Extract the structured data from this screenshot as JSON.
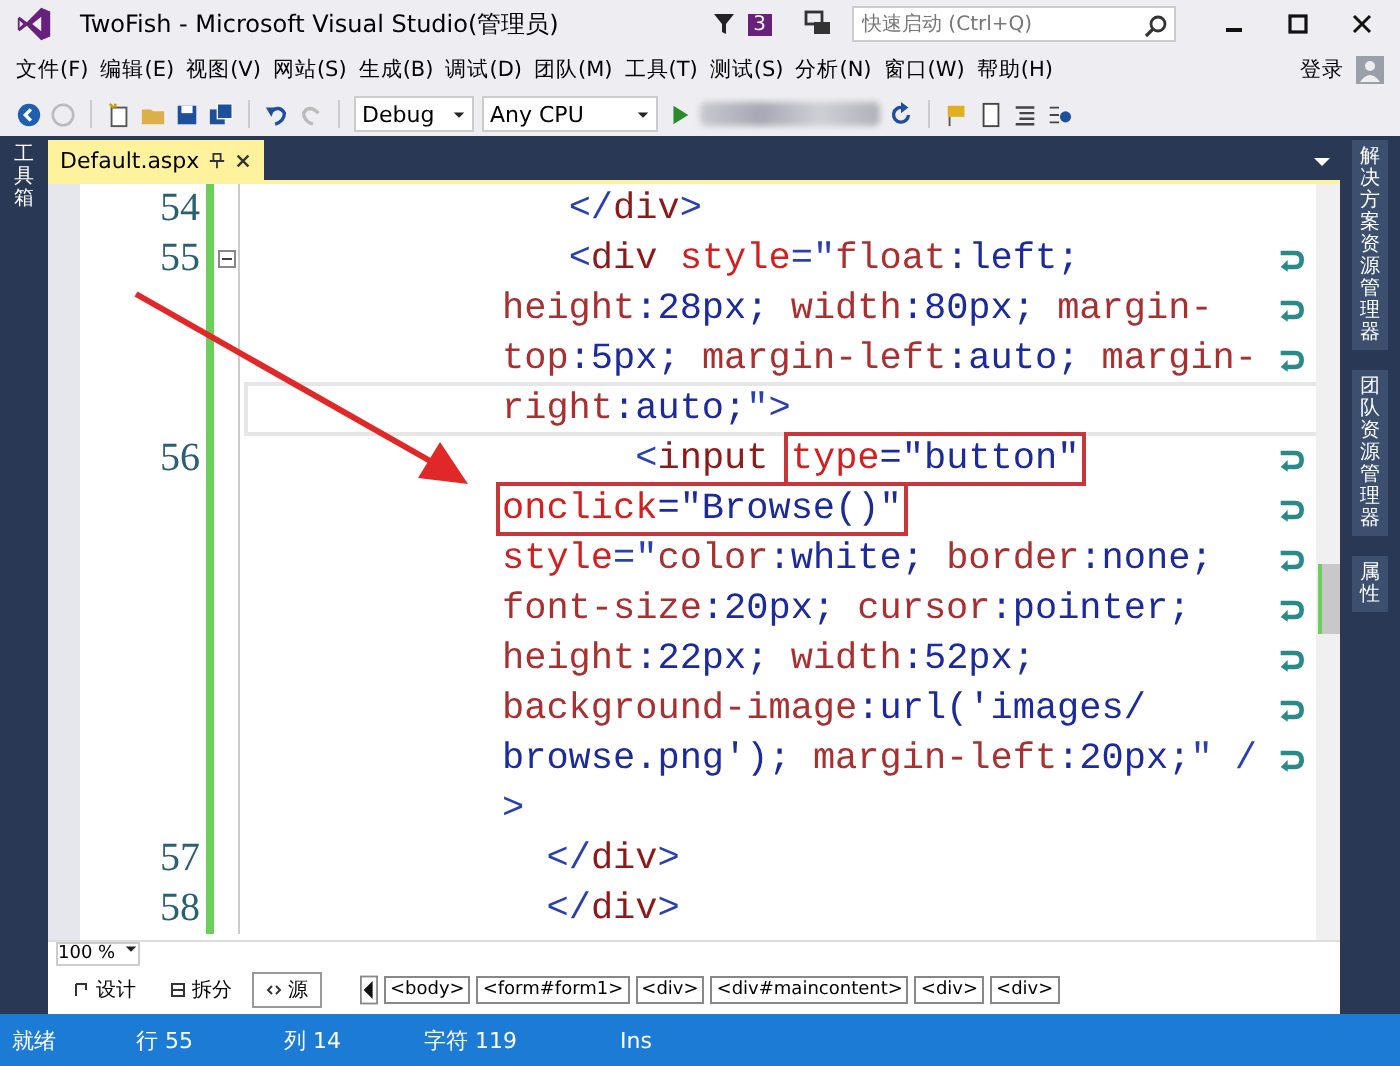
{
  "window": {
    "title": "TwoFish - Microsoft Visual Studio(管理员)",
    "notification_count": "3",
    "quick_launch": {
      "placeholder": "快速启动 (Ctrl+Q)"
    }
  },
  "menu": [
    "文件(F)",
    "编辑(E)",
    "视图(V)",
    "网站(S)",
    "生成(B)",
    "调试(D)",
    "团队(M)",
    "工具(T)",
    "测试(S)",
    "分析(N)",
    "窗口(W)",
    "帮助(H)"
  ],
  "sign_in": "登录",
  "toolbar": {
    "configuration": "Debug",
    "platform": "Any CPU"
  },
  "left_panel": {
    "label": "工具箱"
  },
  "tabs": [
    {
      "label": "Default.aspx",
      "selected": true
    }
  ],
  "right_panel": [
    {
      "label": "解决方案资源管理器"
    },
    {
      "label": "团队资源管理器"
    },
    {
      "label": "属性"
    }
  ],
  "editor": {
    "rows": [
      {
        "number": "54",
        "kind": "inner",
        "wrap": false,
        "current": false,
        "tokens": [
          {
            "kind": "bracket",
            "text": "</"
          },
          {
            "kind": "tag",
            "text": "div"
          },
          {
            "kind": "bracket",
            "text": ">"
          }
        ]
      },
      {
        "number": "55",
        "kind": "inner",
        "wrap": true,
        "current": false,
        "collapsible": true,
        "tokens": [
          {
            "kind": "bracket",
            "text": "<"
          },
          {
            "kind": "tag",
            "text": "div"
          },
          {
            "kind": "attr",
            "text": " style"
          },
          {
            "kind": "bracket",
            "text": "=\""
          },
          {
            "kind": "prop",
            "text": "float"
          },
          {
            "kind": "val",
            "text": ":left;"
          }
        ]
      },
      {
        "kind": "wrap",
        "wrap": true,
        "current": false,
        "tokens": [
          {
            "kind": "prop",
            "text": "height"
          },
          {
            "kind": "val",
            "text": ":28px; "
          },
          {
            "kind": "prop",
            "text": "width"
          },
          {
            "kind": "val",
            "text": ":80px; "
          },
          {
            "kind": "prop",
            "text": "margin-"
          }
        ]
      },
      {
        "kind": "wrap",
        "wrap": true,
        "current": false,
        "tokens": [
          {
            "kind": "prop",
            "text": "top"
          },
          {
            "kind": "val",
            "text": ":5px; "
          },
          {
            "kind": "prop",
            "text": "margin-left"
          },
          {
            "kind": "val",
            "text": ":auto; "
          },
          {
            "kind": "prop",
            "text": "margin-"
          }
        ]
      },
      {
        "kind": "wrap",
        "wrap": false,
        "current": true,
        "tokens": [
          {
            "kind": "prop",
            "text": "right"
          },
          {
            "kind": "val",
            "text": ":auto;"
          },
          {
            "kind": "bracket",
            "text": "\">"
          }
        ]
      },
      {
        "number": "56",
        "kind": "deeper",
        "wrap": true,
        "current": false,
        "tokens": [
          {
            "kind": "bracket",
            "text": "<"
          },
          {
            "kind": "tag",
            "text": "input "
          },
          {
            "kind": "pair",
            "name": "type",
            "value": "=\"button\"",
            "boxed": true
          }
        ]
      },
      {
        "kind": "wrap",
        "wrap": true,
        "current": false,
        "tokens": [
          {
            "kind": "pair",
            "name": "onclick",
            "value": "=\"Browse()\"",
            "boxed": true
          }
        ]
      },
      {
        "kind": "wrap",
        "wrap": true,
        "current": false,
        "tokens": [
          {
            "kind": "attr",
            "text": "style"
          },
          {
            "kind": "bracket",
            "text": "=\""
          },
          {
            "kind": "prop",
            "text": "color"
          },
          {
            "kind": "val",
            "text": ":white; "
          },
          {
            "kind": "prop",
            "text": "border"
          },
          {
            "kind": "val",
            "text": ":none;"
          }
        ]
      },
      {
        "kind": "wrap",
        "wrap": true,
        "current": false,
        "tokens": [
          {
            "kind": "prop",
            "text": "font-size"
          },
          {
            "kind": "val",
            "text": ":20px; "
          },
          {
            "kind": "prop",
            "text": "cursor"
          },
          {
            "kind": "val",
            "text": ":pointer;"
          }
        ]
      },
      {
        "kind": "wrap",
        "wrap": true,
        "current": false,
        "tokens": [
          {
            "kind": "prop",
            "text": "height"
          },
          {
            "kind": "val",
            "text": ":22px; "
          },
          {
            "kind": "prop",
            "text": "width"
          },
          {
            "kind": "val",
            "text": ":52px;"
          }
        ]
      },
      {
        "kind": "wrap",
        "wrap": true,
        "current": false,
        "tokens": [
          {
            "kind": "prop",
            "text": "background-image"
          },
          {
            "kind": "val",
            "text": ":url('images/"
          }
        ]
      },
      {
        "kind": "wrap",
        "wrap": true,
        "current": false,
        "tokens": [
          {
            "kind": "val",
            "text": "browse.png'); "
          },
          {
            "kind": "prop",
            "text": "margin-left"
          },
          {
            "kind": "val",
            "text": ":20px;"
          },
          {
            "kind": "bracket",
            "text": "\" /"
          }
        ]
      },
      {
        "kind": "wrap",
        "wrap": false,
        "current": false,
        "tokens": [
          {
            "kind": "bracket",
            "text": ">"
          }
        ]
      },
      {
        "number": "57",
        "kind": "outer",
        "wrap": false,
        "current": false,
        "tokens": [
          {
            "kind": "bracket",
            "text": "</"
          },
          {
            "kind": "tag",
            "text": "div"
          },
          {
            "kind": "bracket",
            "text": ">"
          }
        ]
      },
      {
        "number": "58",
        "kind": "outer",
        "wrap": false,
        "current": false,
        "tokens": [
          {
            "kind": "bracket",
            "text": "</"
          },
          {
            "kind": "tag",
            "text": "div"
          },
          {
            "kind": "bracket",
            "text": ">"
          }
        ]
      }
    ]
  },
  "zoom": "100 %",
  "views": [
    {
      "label": "设计",
      "kind": "design",
      "selected": false
    },
    {
      "label": "拆分",
      "kind": "split",
      "selected": false
    },
    {
      "label": "源",
      "kind": "source",
      "selected": true
    }
  ],
  "breadcrumb": [
    "<body>",
    "<form#form1>",
    "<div>",
    "<div#maincontent>",
    "<div>",
    "<div>"
  ],
  "status_bar": [
    "就绪",
    "行 55",
    "列 14",
    "字符 119",
    "Ins"
  ]
}
